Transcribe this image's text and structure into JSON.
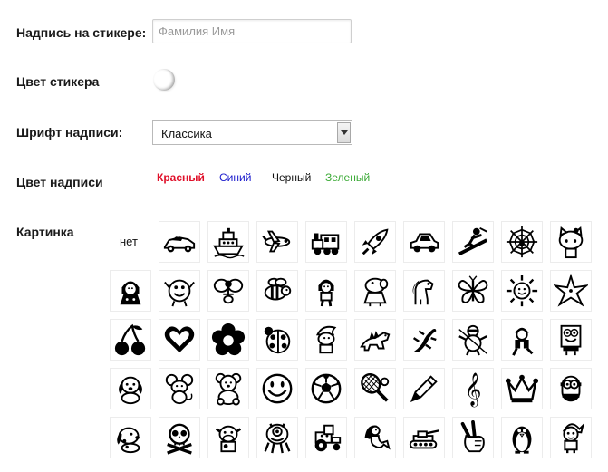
{
  "form": {
    "sticker_text_label": "Надпись на стикере:",
    "sticker_text_placeholder": "Фамилия Имя",
    "sticker_color_label": "Цвет стикера",
    "font_label": "Шрифт надписи:",
    "font_selected": "Классика",
    "text_color_label": "Цвет надписи",
    "text_colors": [
      {
        "label": "Красный",
        "color": "#e0102a"
      },
      {
        "label": "Синий",
        "color": "#1a1acc"
      },
      {
        "label": "Черный",
        "color": "#111111"
      },
      {
        "label": "Зеленый",
        "color": "#3aaa35"
      }
    ],
    "picture_label": "Картинка",
    "picture_none_label": "нет"
  },
  "pictures": [
    [
      "race-car-icon",
      "ship-icon",
      "airplane-icon",
      "train-icon",
      "rocket-icon",
      "small-car-icon",
      "snowboarder-icon",
      "spider-web-icon",
      "hello-kitty-icon"
    ],
    [
      "masha-icon",
      "smesharik-icon",
      "butterfly-fairy-icon",
      "bee-icon",
      "dora-icon",
      "peppa-pig-icon",
      "pony-icon",
      "butterfly-icon",
      "sun-icon",
      "starfish-icon"
    ],
    [
      "cherries-icon",
      "heart-icon",
      "flower-icon",
      "ladybug-icon",
      "smurf-icon",
      "dinosaur-icon",
      "lizard-icon",
      "ninja-turtle-icon",
      "ben10-icon",
      "spongebob-icon"
    ],
    [
      "puppy-icon",
      "mouse-icon",
      "teddy-bear-icon",
      "smiley-icon",
      "soccer-ball-icon",
      "tennis-racket-icon",
      "pencil-icon",
      "treble-clef-icon",
      "crown-icon",
      "minion-icon"
    ],
    [
      "blues-clues-dog-icon",
      "skull-crossbones-icon",
      "cow-icon",
      "monster-icon",
      "tractor-icon",
      "mermaid-icon",
      "tank-icon",
      "peace-hand-icon",
      "penguin-icon",
      "fixie-icon"
    ]
  ]
}
